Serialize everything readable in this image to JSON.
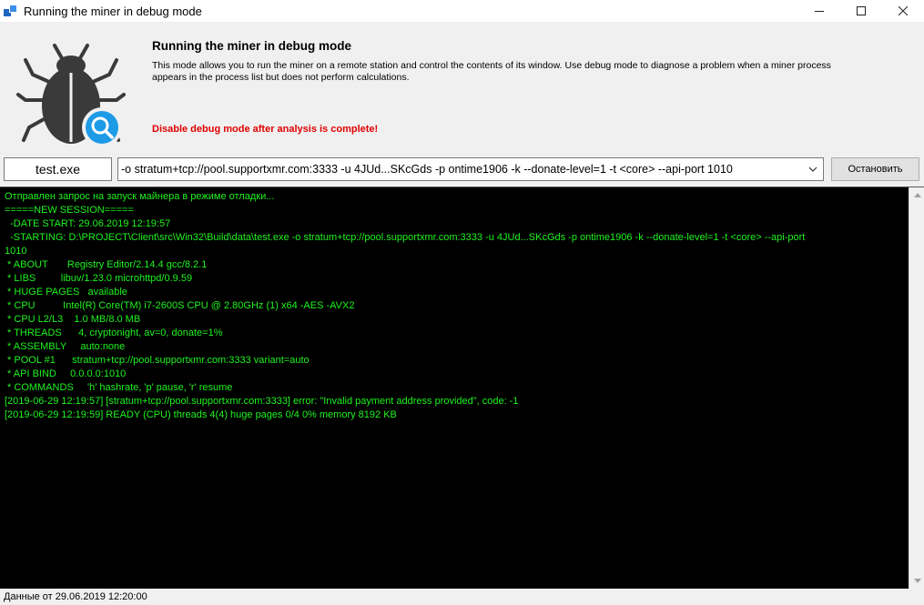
{
  "window": {
    "title": "Running the miner in debug mode",
    "minimize_icon": "minimize-icon",
    "maximize_icon": "maximize-icon",
    "close_icon": "close-icon"
  },
  "header": {
    "icon": "bug-magnifier-icon",
    "title": "Running the miner in debug mode",
    "description": "This mode allows you to run the miner on a remote station and control the contents of its window. Use debug mode to diagnose a problem when a miner process appears in the process list but does not perform calculations.",
    "warning": "Disable debug mode after analysis is complete!",
    "warning_color": "#e00000"
  },
  "command": {
    "exe": "test.exe",
    "args": "-o stratum+tcp://pool.supportxmr.com:3333 -u 4JUd...SKcGds -p ontime1906 -k --donate-level=1 -t <core> --api-port 1010",
    "stop_label": "Остановить"
  },
  "console": {
    "text_color": "#1ff31f",
    "lines": [
      "Отправлен запрос на запуск майнера в режиме отладки...",
      "=====NEW SESSION=====",
      "  -DATE START: 29.06.2019 12:19:57",
      "  -STARTING: D:\\PROJECT\\Client\\src\\Win32\\Build\\data\\test.exe -o stratum+tcp://pool.supportxmr.com:3333 -u 4JUd...SKcGds -p ontime1906 -k --donate-level=1 -t <core> --api-port",
      "1010",
      " * ABOUT       Registry Editor/2.14.4 gcc/8.2.1",
      " * LIBS         libuv/1.23.0 microhttpd/0.9.59",
      " * HUGE PAGES   available",
      " * CPU          Intel(R) Core(TM) i7-2600S CPU @ 2.80GHz (1) x64 -AES -AVX2",
      " * CPU L2/L3    1.0 MB/8.0 MB",
      " * THREADS      4, cryptonight, av=0, donate=1%",
      " * ASSEMBLY     auto:none",
      " * POOL #1      stratum+tcp://pool.supportxmr.com:3333 variant=auto",
      " * API BIND     0.0.0.0:1010",
      " * COMMANDS     'h' hashrate, 'p' pause, 'r' resume",
      "[2019-06-29 12:19:57] [stratum+tcp://pool.supportxmr.com:3333] error: \"Invalid payment address provided\", code: -1",
      "[2019-06-29 12:19:59] READY (CPU) threads 4(4) huge pages 0/4 0% memory 8192 KB"
    ]
  },
  "status": {
    "text": "Данные от 29.06.2019 12:20:00"
  }
}
